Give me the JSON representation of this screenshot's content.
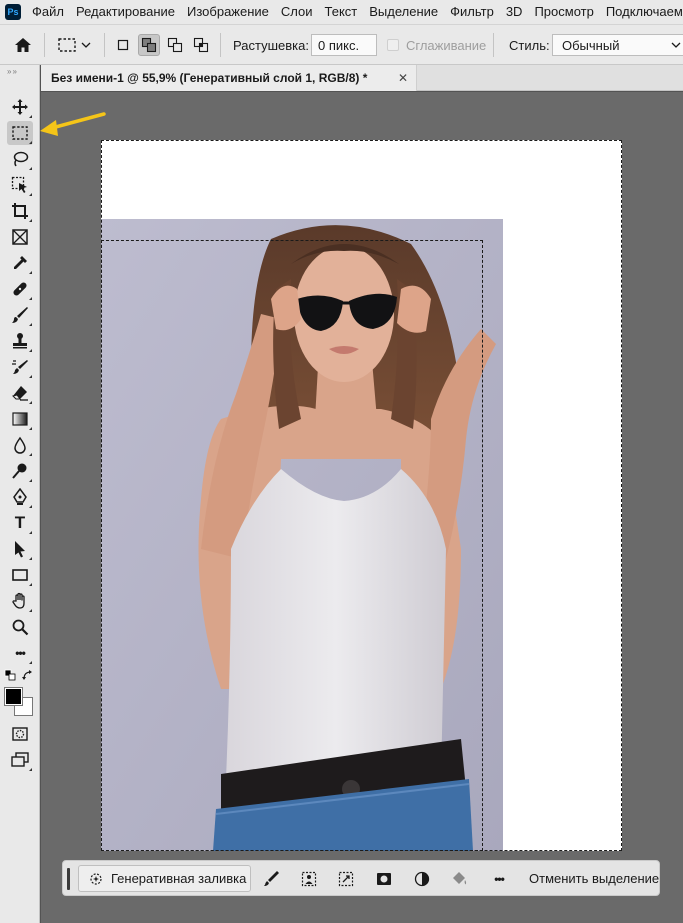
{
  "menubar": {
    "logo": "Ps",
    "items": [
      "Файл",
      "Редактирование",
      "Изображение",
      "Слои",
      "Текст",
      "Выделение",
      "Фильтр",
      "3D",
      "Просмотр",
      "Подключаемые моду"
    ]
  },
  "options": {
    "feather_label": "Растушевка:",
    "feather_value": "0 пикс.",
    "antialias_label": "Сглаживание",
    "style_label": "Стиль:",
    "style_value": "Обычный",
    "selection_modes": [
      "new-selection",
      "add-to-selection",
      "subtract-from-selection",
      "intersect-selection"
    ],
    "active_selection_mode": "add-to-selection"
  },
  "document": {
    "tab_title": "Без имени-1 @ 55,9% (Генеративный слой 1, RGB/8) *",
    "zoom_percent": 55.9,
    "color_mode": "RGB/8"
  },
  "toolbar": {
    "active_tool": "rectangular-marquee-tool",
    "tools": [
      "move-tool",
      "rectangular-marquee-tool",
      "lasso-tool",
      "object-selection-tool",
      "crop-tool",
      "frame-tool",
      "eyedropper-tool",
      "spot-healing-brush-tool",
      "brush-tool",
      "clone-stamp-tool",
      "history-brush-tool",
      "eraser-tool",
      "gradient-tool",
      "blur-tool",
      "dodge-tool",
      "pen-tool",
      "type-tool",
      "path-selection-tool",
      "rectangle-tool",
      "hand-tool",
      "zoom-tool",
      "edit-toolbar-more"
    ],
    "type_glyph": "T",
    "more_glyph": "•••",
    "foreground_color": "#000000",
    "background_color": "#ffffff"
  },
  "contextual_bar": {
    "generative_fill_label": "Генеративная заливка",
    "deselect_label": "Отменить выделение",
    "more_glyph": "•••"
  },
  "colors": {
    "highlight_arrow": "#f5c518",
    "menubar_bg": "#e9e9e9",
    "workspace_bg": "#6a6a6a"
  }
}
